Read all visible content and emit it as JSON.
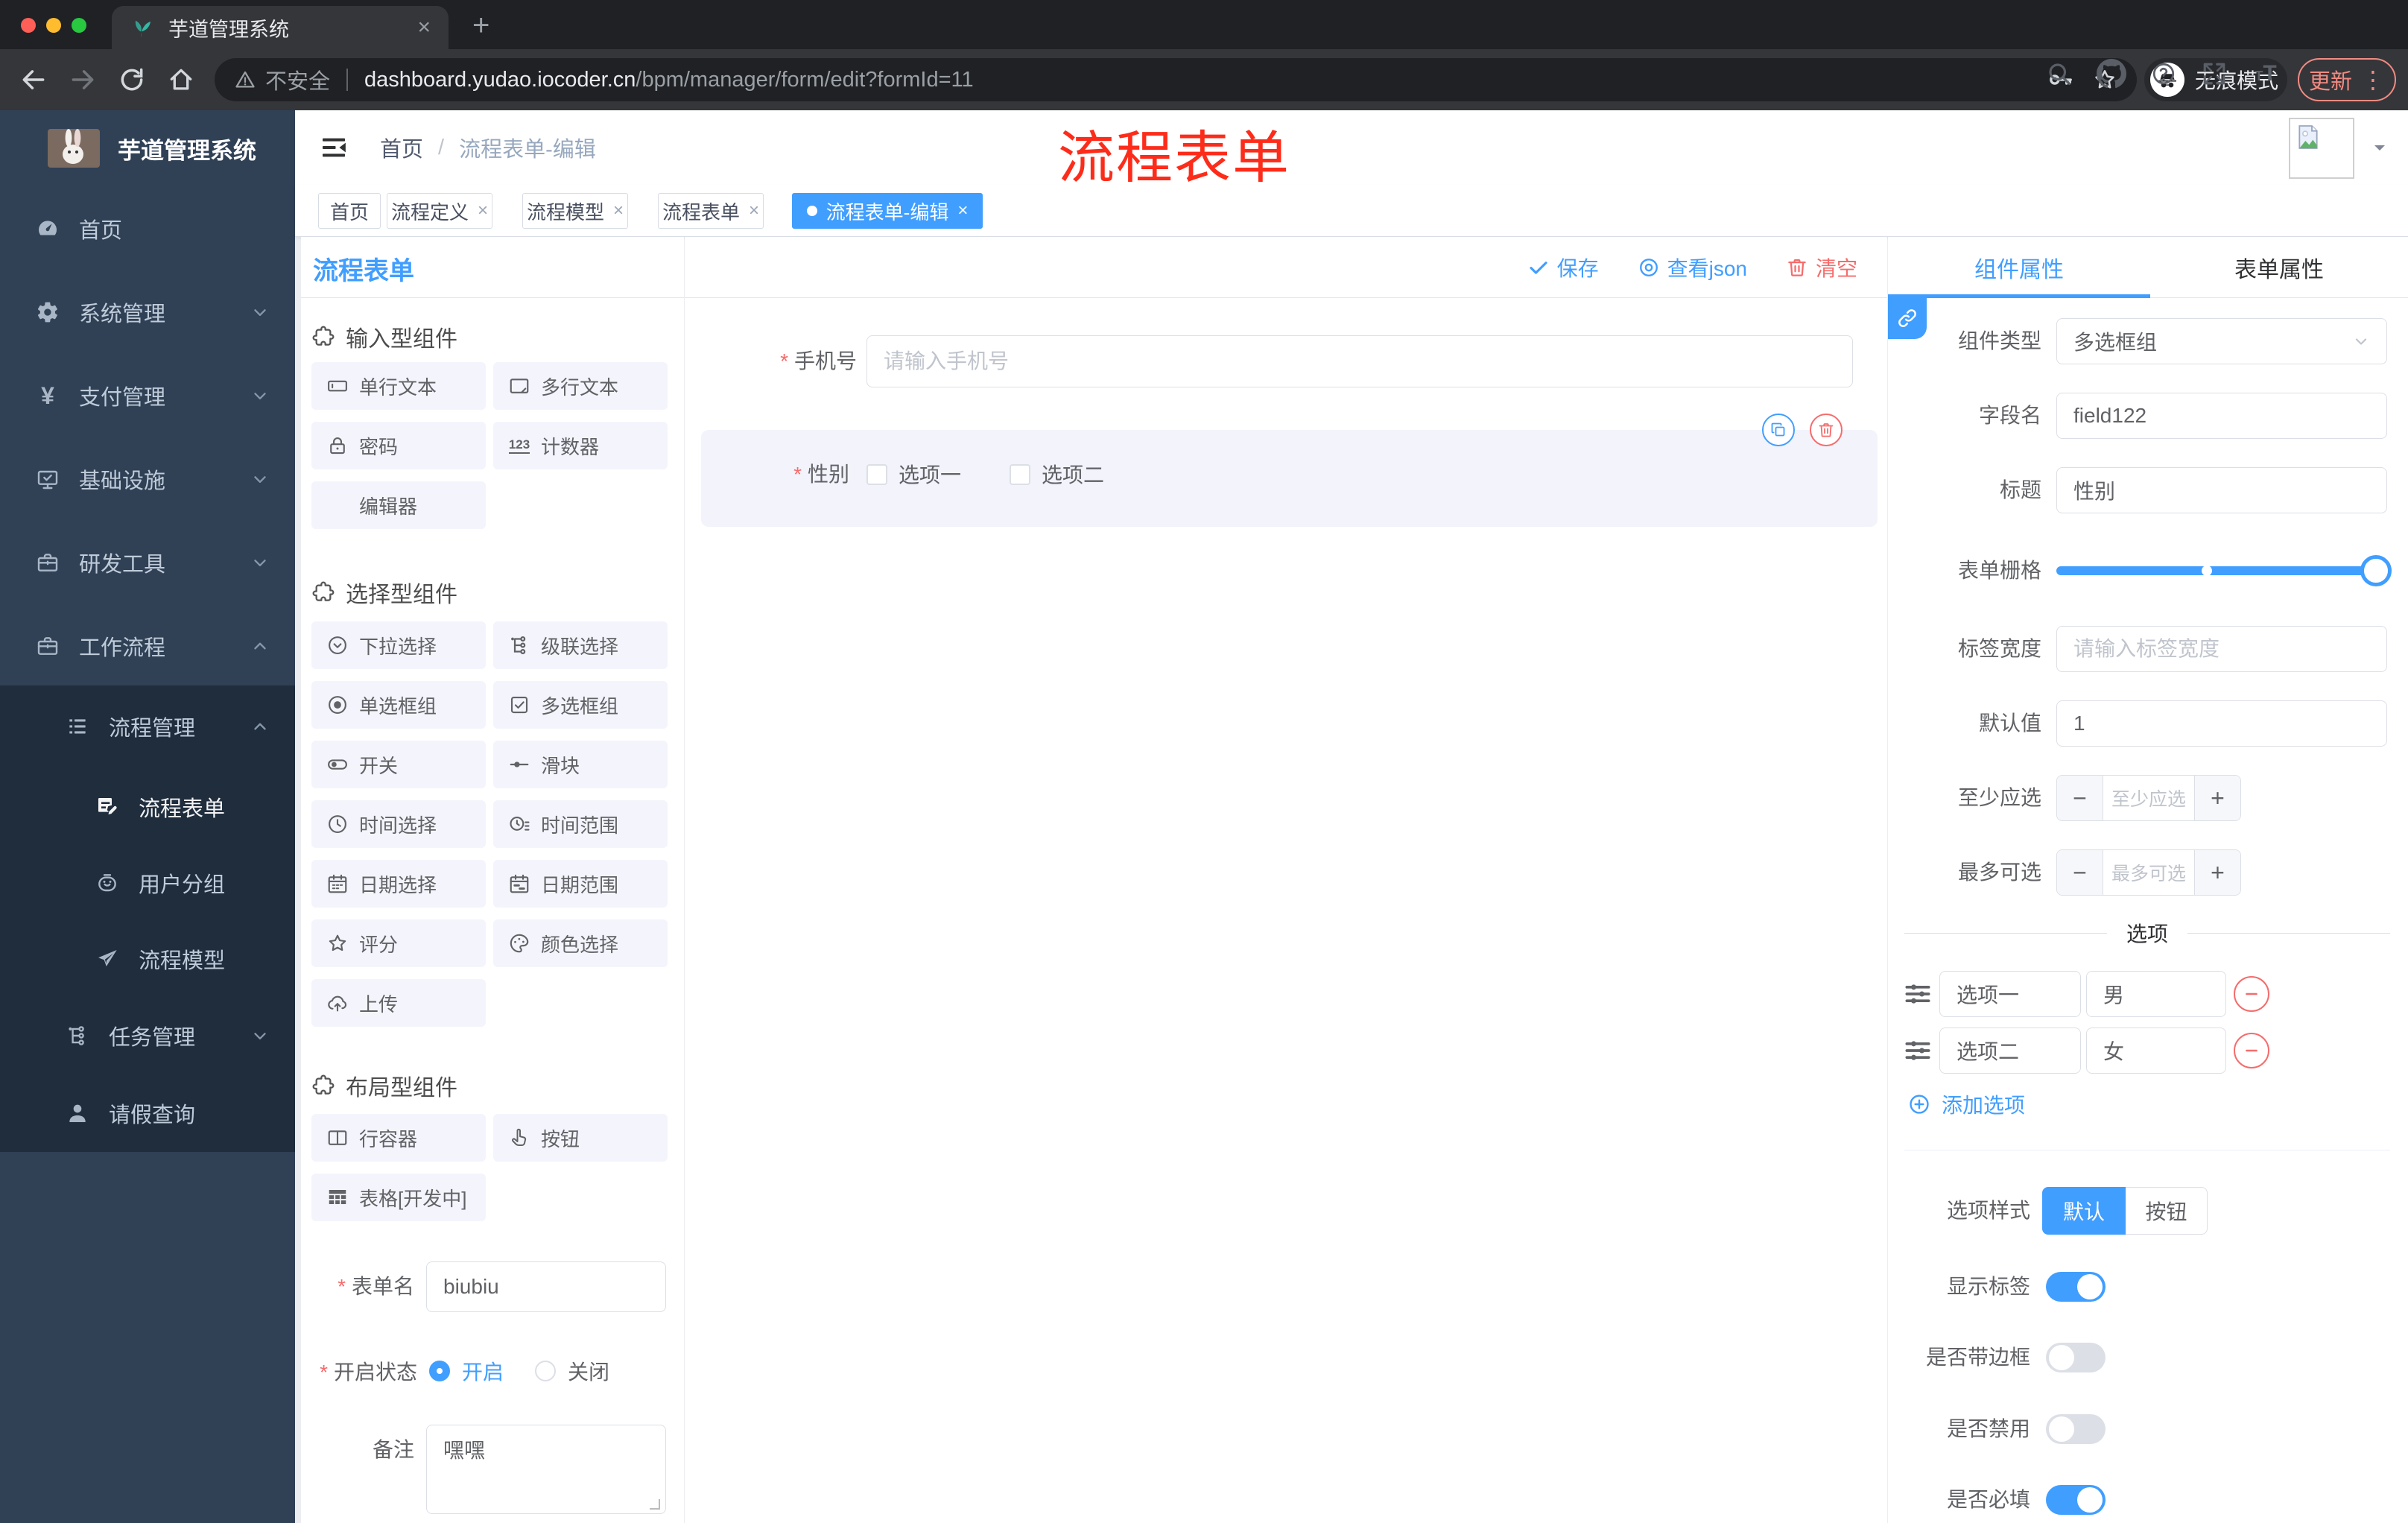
{
  "colors": {
    "primary": "#409EFF",
    "danger": "#F56C6C",
    "annotation_red": "#FD2C1A",
    "sidebar_bg": "#304156",
    "submenu_bg": "#1F2D3D",
    "tab_active_bg": "#409EFF"
  },
  "browser": {
    "tab_title": "芋道管理系统",
    "security_label": "不安全",
    "url_host": "dashboard.yudao.iocoder.cn",
    "url_path": "/bpm/manager/form/edit?formId=11",
    "incognito_label": "无痕模式",
    "update_label": "更新"
  },
  "sidebar": {
    "brand": "芋道管理系统",
    "items": [
      {
        "label": "首页"
      },
      {
        "label": "系统管理"
      },
      {
        "label": "支付管理"
      },
      {
        "label": "基础设施"
      },
      {
        "label": "研发工具"
      },
      {
        "label": "工作流程"
      }
    ],
    "submenu": [
      {
        "label": "流程管理"
      },
      {
        "label": "流程表单"
      },
      {
        "label": "用户分组"
      },
      {
        "label": "流程模型"
      },
      {
        "label": "任务管理"
      },
      {
        "label": "请假查询"
      }
    ]
  },
  "header": {
    "breadcrumb_home": "首页",
    "breadcrumb_current": "流程表单-编辑"
  },
  "tags": [
    {
      "label": "首页",
      "closable": false,
      "active": false
    },
    {
      "label": "流程定义",
      "closable": true,
      "active": false
    },
    {
      "label": "流程模型",
      "closable": true,
      "active": false
    },
    {
      "label": "流程表单",
      "closable": true,
      "active": false
    },
    {
      "label": "流程表单-编辑",
      "closable": true,
      "active": true
    }
  ],
  "annotation": {
    "text": "流程表单"
  },
  "palette": {
    "title": "流程表单",
    "sections": [
      {
        "title": "输入型组件",
        "items": [
          {
            "label": "单行文本",
            "icon": "input"
          },
          {
            "label": "多行文本",
            "icon": "textarea"
          },
          {
            "label": "密码",
            "icon": "lock"
          },
          {
            "label": "计数器",
            "icon": "counter"
          },
          {
            "label": "编辑器",
            "icon": ""
          }
        ]
      },
      {
        "title": "选择型组件",
        "items": [
          {
            "label": "下拉选择",
            "icon": "select"
          },
          {
            "label": "级联选择",
            "icon": "cascader"
          },
          {
            "label": "单选框组",
            "icon": "radio"
          },
          {
            "label": "多选框组",
            "icon": "checkbox"
          },
          {
            "label": "开关",
            "icon": "switch"
          },
          {
            "label": "滑块",
            "icon": "slider"
          },
          {
            "label": "时间选择",
            "icon": "time"
          },
          {
            "label": "时间范围",
            "icon": "timerange"
          },
          {
            "label": "日期选择",
            "icon": "date"
          },
          {
            "label": "日期范围",
            "icon": "daterange"
          },
          {
            "label": "评分",
            "icon": "rate"
          },
          {
            "label": "颜色选择",
            "icon": "color"
          },
          {
            "label": "上传",
            "icon": "upload"
          }
        ]
      },
      {
        "title": "布局型组件",
        "items": [
          {
            "label": "行容器",
            "icon": "row"
          },
          {
            "label": "按钮",
            "icon": "button"
          },
          {
            "label": "表格[开发中]",
            "icon": "table"
          }
        ]
      }
    ],
    "form": {
      "name_label": "表单名",
      "name_value": "biubiu",
      "status_label": "开启状态",
      "status_on": "开启",
      "status_off": "关闭",
      "remark_label": "备注",
      "remark_value": "嘿嘿"
    }
  },
  "canvas": {
    "toolbar": {
      "save": "保存",
      "view_json": "查看json",
      "clear": "清空"
    },
    "phone": {
      "label": "手机号",
      "placeholder": "请输入手机号"
    },
    "gender": {
      "label": "性别",
      "option1": "选项一",
      "option2": "选项二"
    }
  },
  "inspector": {
    "tab_component": "组件属性",
    "tab_form": "表单属性",
    "component_type_label": "组件类型",
    "component_type_value": "多选框组",
    "field_name_label": "字段名",
    "field_name_value": "field122",
    "title_label": "标题",
    "title_value": "性别",
    "grid_label": "表单栅格",
    "label_width_label": "标签宽度",
    "label_width_placeholder": "请输入标签宽度",
    "default_label": "默认值",
    "default_value": "1",
    "min_label": "至少应选",
    "min_placeholder": "至少应选",
    "max_label": "最多可选",
    "max_placeholder": "最多可选",
    "options_title": "选项",
    "options": [
      {
        "label": "选项一",
        "value": "男"
      },
      {
        "label": "选项二",
        "value": "女"
      }
    ],
    "add_option": "添加选项",
    "style_label": "选项样式",
    "style_default": "默认",
    "style_button": "按钮",
    "toggles": [
      {
        "label": "显示标签",
        "on": true
      },
      {
        "label": "是否带边框",
        "on": false
      },
      {
        "label": "是否禁用",
        "on": false
      },
      {
        "label": "是否必填",
        "on": true
      }
    ]
  }
}
